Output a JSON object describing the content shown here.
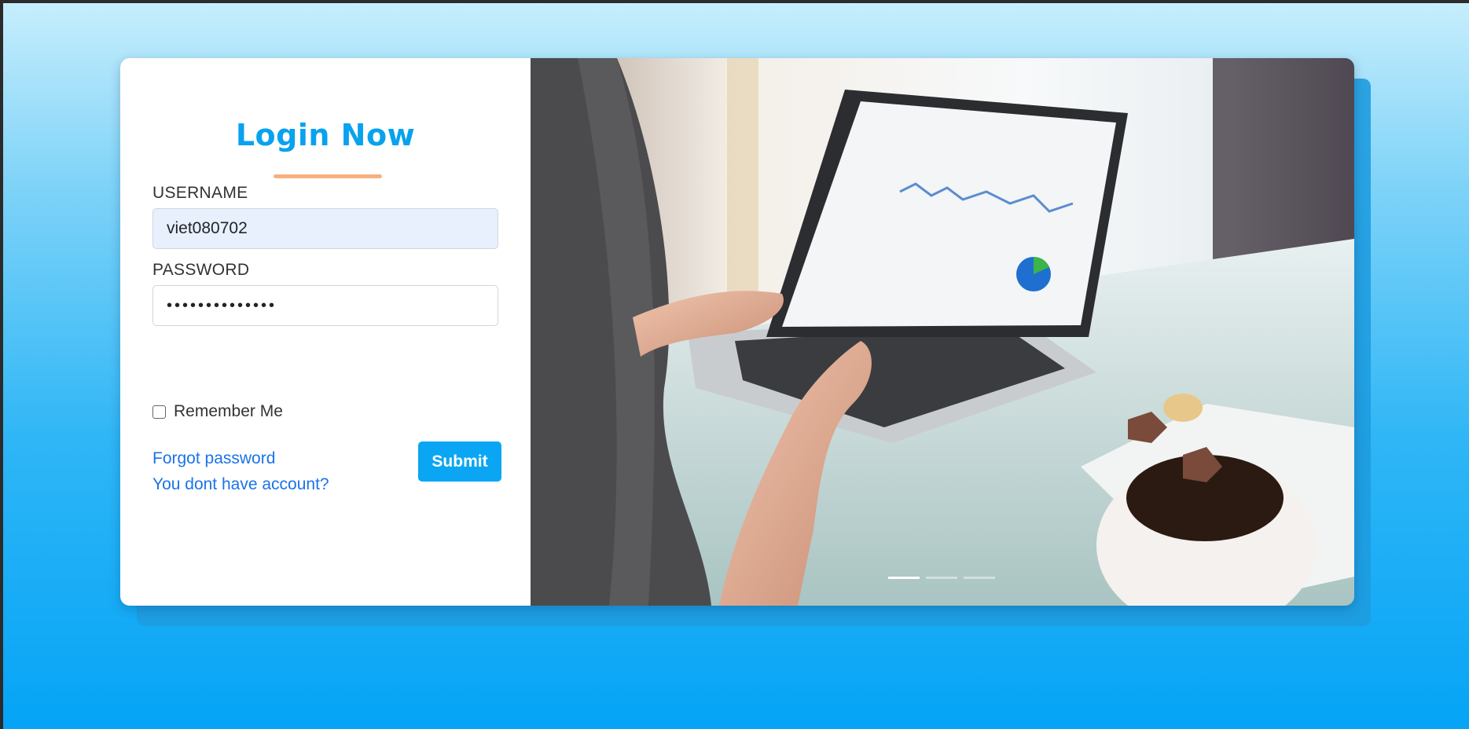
{
  "login": {
    "title": "Login Now",
    "username_label": "USERNAME",
    "username_value": "viet080702",
    "password_label": "PASSWORD",
    "password_value": "••••••••••••••",
    "remember_label": "Remember Me",
    "remember_checked": false,
    "forgot_link": "Forgot password",
    "signup_link": "You dont have account?",
    "submit_label": "Submit"
  },
  "carousel": {
    "slide_count": 3,
    "active_index": 0
  },
  "colors": {
    "accent": "#08a2ee",
    "underline": "#f7b07e",
    "link": "#1a73e8",
    "background_top": "#c6eefc",
    "background_bottom": "#05a4f6"
  }
}
